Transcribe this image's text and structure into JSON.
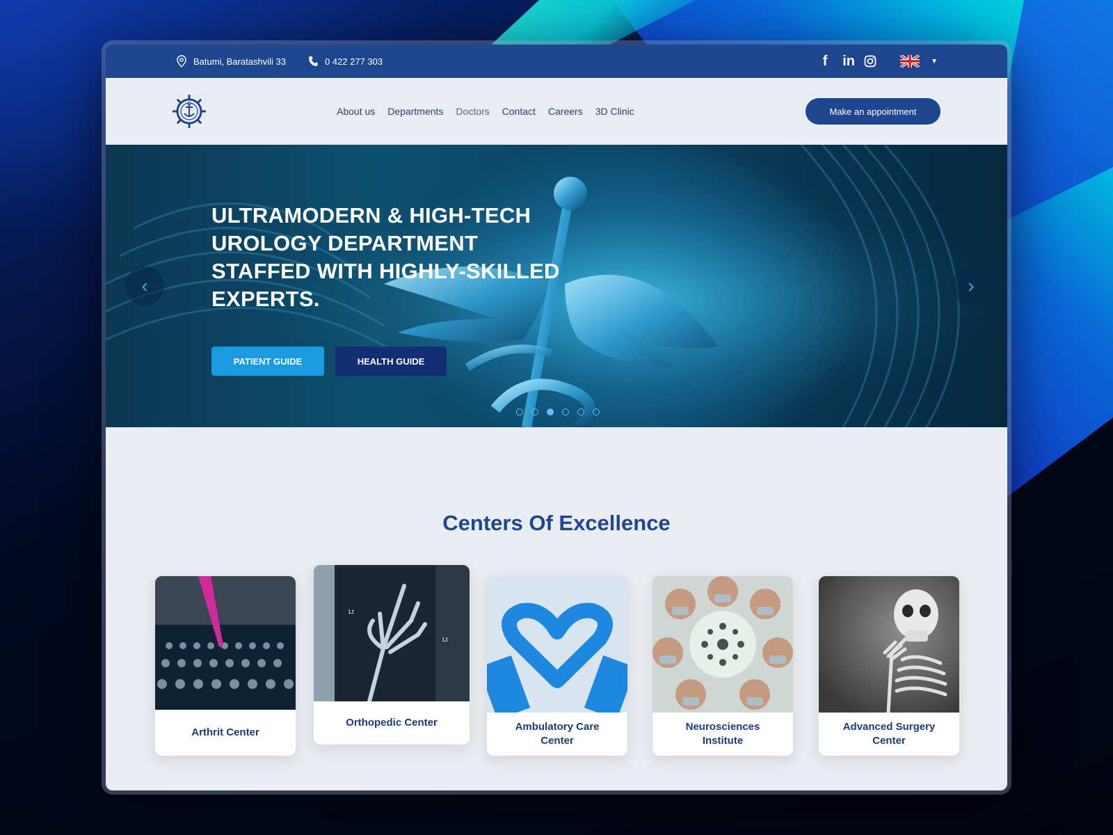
{
  "topbar": {
    "address": "Batumi, Baratashvili 33",
    "phone": "0 422 277 303",
    "social": [
      "f",
      "in"
    ],
    "language": "English"
  },
  "nav": {
    "items": [
      {
        "label": "About us"
      },
      {
        "label": "Departments"
      },
      {
        "label": "Doctors"
      },
      {
        "label": "Contact"
      },
      {
        "label": "Careers"
      },
      {
        "label": "3D Clinic"
      }
    ],
    "cta": "Make an appointment"
  },
  "hero": {
    "title": "ULTRAMODERN & HIGH-TECH UROLOGY DEPARTMENT STAFFED WITH HIGHLY-SKILLED EXPERTS.",
    "primary_button": "PATIENT GUIDE",
    "secondary_button": "HEALTH GUIDE",
    "slides_total": 6,
    "active_slide": 3
  },
  "centers": {
    "title": "Centers Of Excellence",
    "cards": [
      {
        "label": "Arthrit Center"
      },
      {
        "label": "Orthopedic Center"
      },
      {
        "label": "Ambulatory Care Center"
      },
      {
        "label": "Neurosciences Institute"
      },
      {
        "label": "Advanced Surgery Center"
      }
    ]
  },
  "colors": {
    "brand": "#1e4690",
    "accent": "#1a9be0",
    "heading": "#1e4690"
  }
}
